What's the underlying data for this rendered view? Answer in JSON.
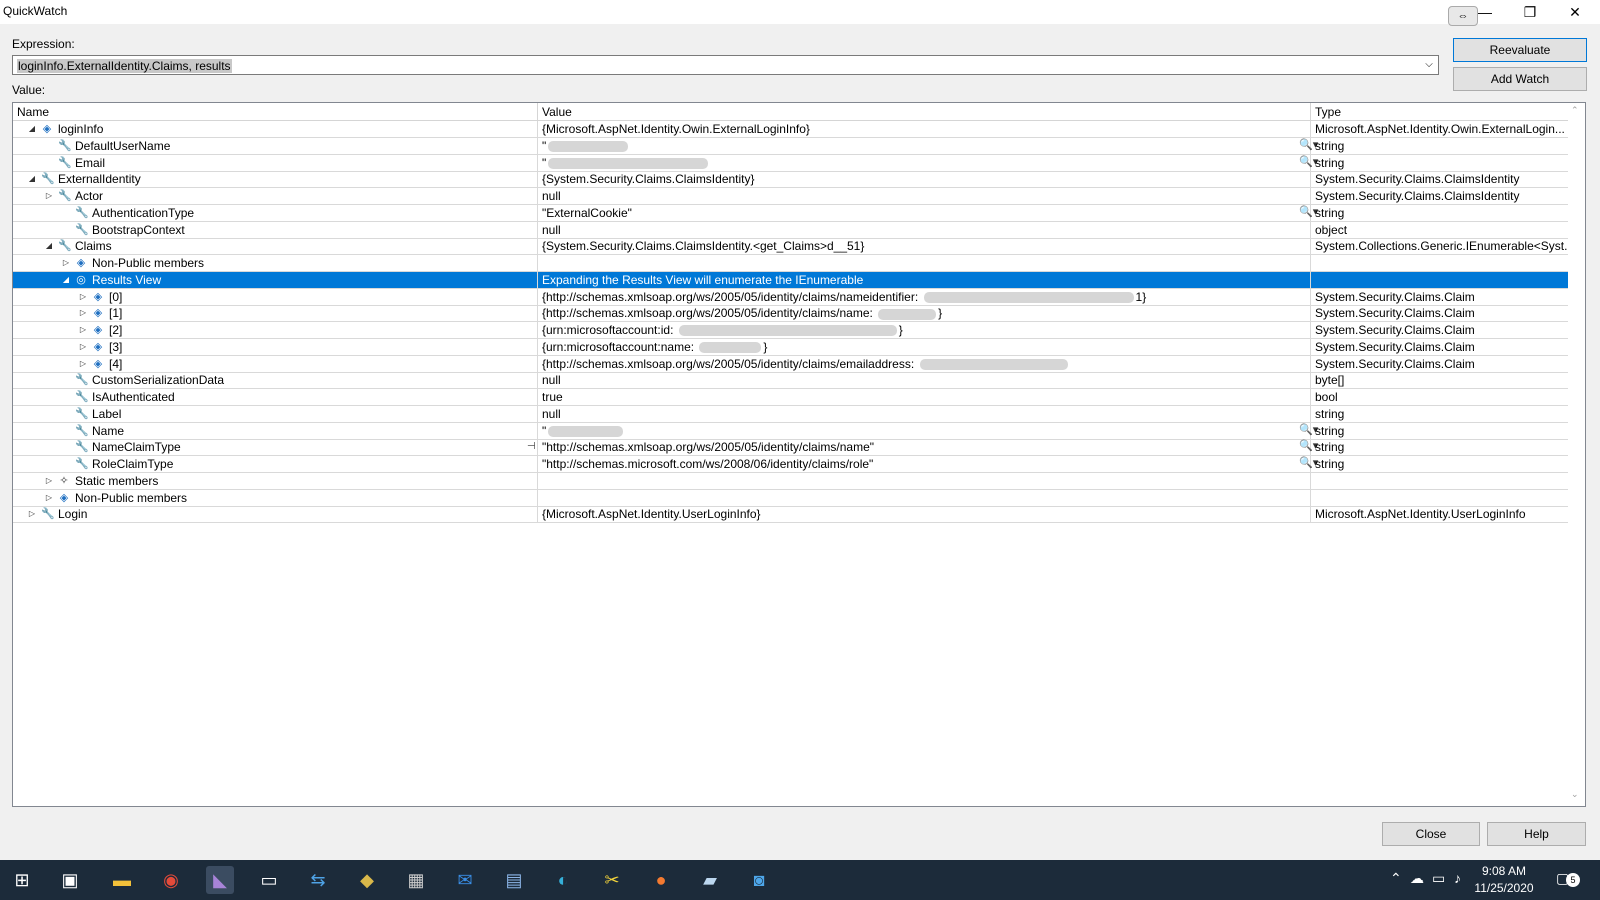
{
  "window": {
    "title": "QuickWatch"
  },
  "expression": {
    "label": "Expression:",
    "value": "loginInfo.ExternalIdentity.Claims, results"
  },
  "buttons": {
    "reevaluate": "Reevaluate",
    "add_watch": "Add Watch",
    "close": "Close",
    "help": "Help"
  },
  "value_label": "Value:",
  "columns": {
    "name": "Name",
    "value": "Value",
    "type": "Type"
  },
  "rows": [
    {
      "name": "loginInfo",
      "value": "{Microsoft.AspNet.Identity.Owin.ExternalLoginInfo}",
      "type": "Microsoft.AspNet.Identity.Owin.ExternalLogin..."
    },
    {
      "name": "DefaultUserName",
      "value": "\"",
      "type": "string"
    },
    {
      "name": "Email",
      "value": "\"",
      "type": "string"
    },
    {
      "name": "ExternalIdentity",
      "value": "{System.Security.Claims.ClaimsIdentity}",
      "type": "System.Security.Claims.ClaimsIdentity"
    },
    {
      "name": "Actor",
      "value": "null",
      "type": "System.Security.Claims.ClaimsIdentity"
    },
    {
      "name": "AuthenticationType",
      "value": "\"ExternalCookie\"",
      "type": "string"
    },
    {
      "name": "BootstrapContext",
      "value": "null",
      "type": "object"
    },
    {
      "name": "Claims",
      "value": "{System.Security.Claims.ClaimsIdentity.<get_Claims>d__51}",
      "type": "System.Collections.Generic.IEnumerable<Syst..."
    },
    {
      "name": "Non-Public members",
      "value": "",
      "type": ""
    },
    {
      "name": "Results View",
      "value": "Expanding the Results View will enumerate the IEnumerable",
      "type": ""
    },
    {
      "name": "[0]",
      "value": "{http://schemas.xmlsoap.org/ws/2005/05/identity/claims/nameidentifier: ",
      "value_end": "1}",
      "type": "System.Security.Claims.Claim"
    },
    {
      "name": "[1]",
      "value": "{http://schemas.xmlsoap.org/ws/2005/05/identity/claims/name: ",
      "value_end": "}",
      "type": "System.Security.Claims.Claim"
    },
    {
      "name": "[2]",
      "value": "{urn:microsoftaccount:id: ",
      "value_end": "}",
      "type": "System.Security.Claims.Claim"
    },
    {
      "name": "[3]",
      "value": "{urn:microsoftaccount:name: ",
      "value_end": "}",
      "type": "System.Security.Claims.Claim"
    },
    {
      "name": "[4]",
      "value": "{http://schemas.xmlsoap.org/ws/2005/05/identity/claims/emailaddress: ",
      "value_end": "",
      "type": "System.Security.Claims.Claim"
    },
    {
      "name": "CustomSerializationData",
      "value": "null",
      "type": "byte[]"
    },
    {
      "name": "IsAuthenticated",
      "value": "true",
      "type": "bool"
    },
    {
      "name": "Label",
      "value": "null",
      "type": "string"
    },
    {
      "name": "Name",
      "value": "\"",
      "type": "string"
    },
    {
      "name": "NameClaimType",
      "value": "\"http://schemas.xmlsoap.org/ws/2005/05/identity/claims/name\"",
      "type": "string"
    },
    {
      "name": "RoleClaimType",
      "value": "\"http://schemas.microsoft.com/ws/2008/06/identity/claims/role\"",
      "type": "string"
    },
    {
      "name": "Static members",
      "value": "",
      "type": ""
    },
    {
      "name": "Non-Public members",
      "value": "",
      "type": ""
    },
    {
      "name": "Login",
      "value": "{Microsoft.AspNet.Identity.UserLoginInfo}",
      "type": "Microsoft.AspNet.Identity.UserLoginInfo"
    }
  ],
  "taskbar": {
    "time": "9:08 AM",
    "date": "11/25/2020",
    "notification_count": "5"
  },
  "icons": {
    "wrench": "wrench-icon",
    "cube": "object-cube-icon",
    "results": "results-view-icon",
    "static": "static-members-icon",
    "magnifier": "text-visualizer-icon",
    "pin": "pin-icon"
  },
  "colors": {
    "selection": "#0078d7",
    "taskbar": "#1c2b3a",
    "object_icon": "#1e6fc1"
  }
}
